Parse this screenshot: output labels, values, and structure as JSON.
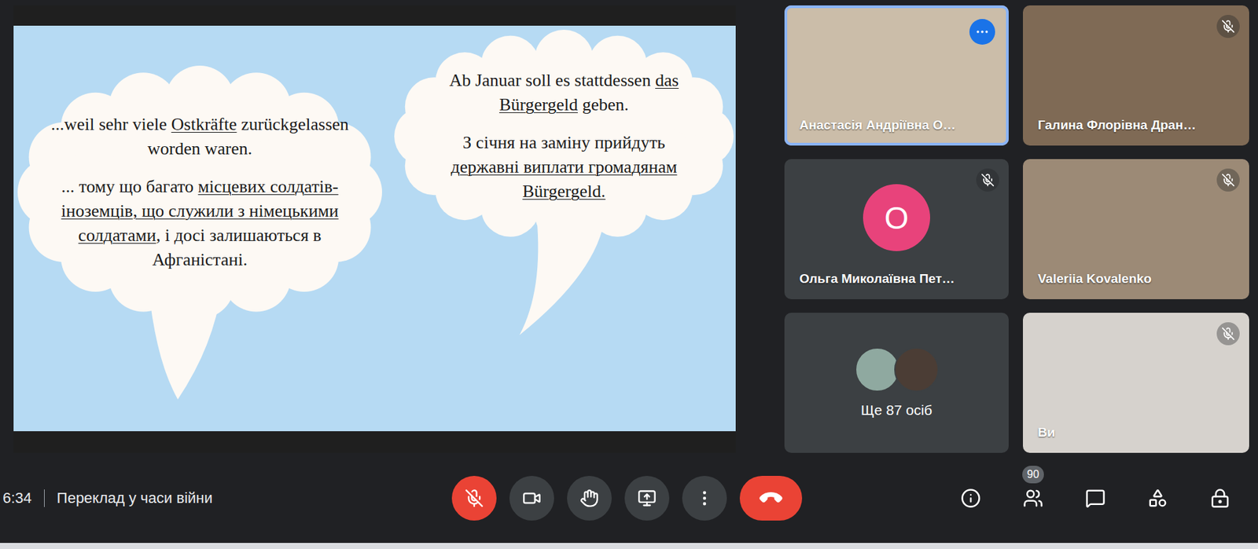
{
  "meeting": {
    "time": "6:34",
    "title": "Переклад у часи війни"
  },
  "slide": {
    "bubbles": [
      {
        "paragraphs": [
          [
            {
              "text": "...weil sehr viele ",
              "underline": false
            },
            {
              "text": "Ostkräfte",
              "underline": true
            },
            {
              "text": " zurückgelassen worden waren.",
              "underline": false
            }
          ],
          [
            {
              "text": "... тому що багато ",
              "underline": false
            },
            {
              "text": "місцевих солдатів-іноземців, що служили з німецькими солдатами",
              "underline": true
            },
            {
              "text": ", і досі залишаються в Афганістані.",
              "underline": false
            }
          ]
        ]
      },
      {
        "paragraphs": [
          [
            {
              "text": "Ab Januar soll es stattdessen ",
              "underline": false
            },
            {
              "text": "das Bürgergeld",
              "underline": true
            },
            {
              "text": " geben.",
              "underline": false
            }
          ],
          [
            {
              "text": "З січня на заміну прийдуть ",
              "underline": false
            },
            {
              "text": "державні виплати громадянам Bürgergeld.",
              "underline": true
            }
          ]
        ]
      }
    ]
  },
  "participants": [
    {
      "kind": "video",
      "name": "Анастасія Андріївна О…",
      "muted": false,
      "speaking": true,
      "actions_shown": true
    },
    {
      "kind": "video",
      "name": "Галина Флорівна Дран…",
      "muted": true,
      "speaking": false,
      "actions_shown": false
    },
    {
      "kind": "avatar",
      "name": "Ольга Миколаївна Пет…",
      "initial": "О",
      "color": "#e8437b",
      "muted": true,
      "speaking": false,
      "actions_shown": false
    },
    {
      "kind": "video",
      "name": "Valeriia Kovalenko",
      "muted": true,
      "speaking": false,
      "actions_shown": false
    },
    {
      "kind": "group",
      "label": "Ще 87 осіб",
      "photos": 2
    },
    {
      "kind": "video",
      "name": "Ви",
      "muted": true,
      "speaking": false,
      "actions_shown": false
    }
  ],
  "controls": [
    {
      "kind": "mic",
      "muted": true
    },
    {
      "kind": "camera",
      "muted": false
    },
    {
      "kind": "hand",
      "muted": false
    },
    {
      "kind": "present",
      "muted": false
    },
    {
      "kind": "more",
      "muted": false
    },
    {
      "kind": "leave",
      "muted": false
    }
  ],
  "side_buttons": [
    {
      "kind": "info",
      "badge": ""
    },
    {
      "kind": "people",
      "badge": "90"
    },
    {
      "kind": "chat",
      "badge": ""
    },
    {
      "kind": "activities",
      "badge": ""
    },
    {
      "kind": "host",
      "badge": ""
    }
  ]
}
